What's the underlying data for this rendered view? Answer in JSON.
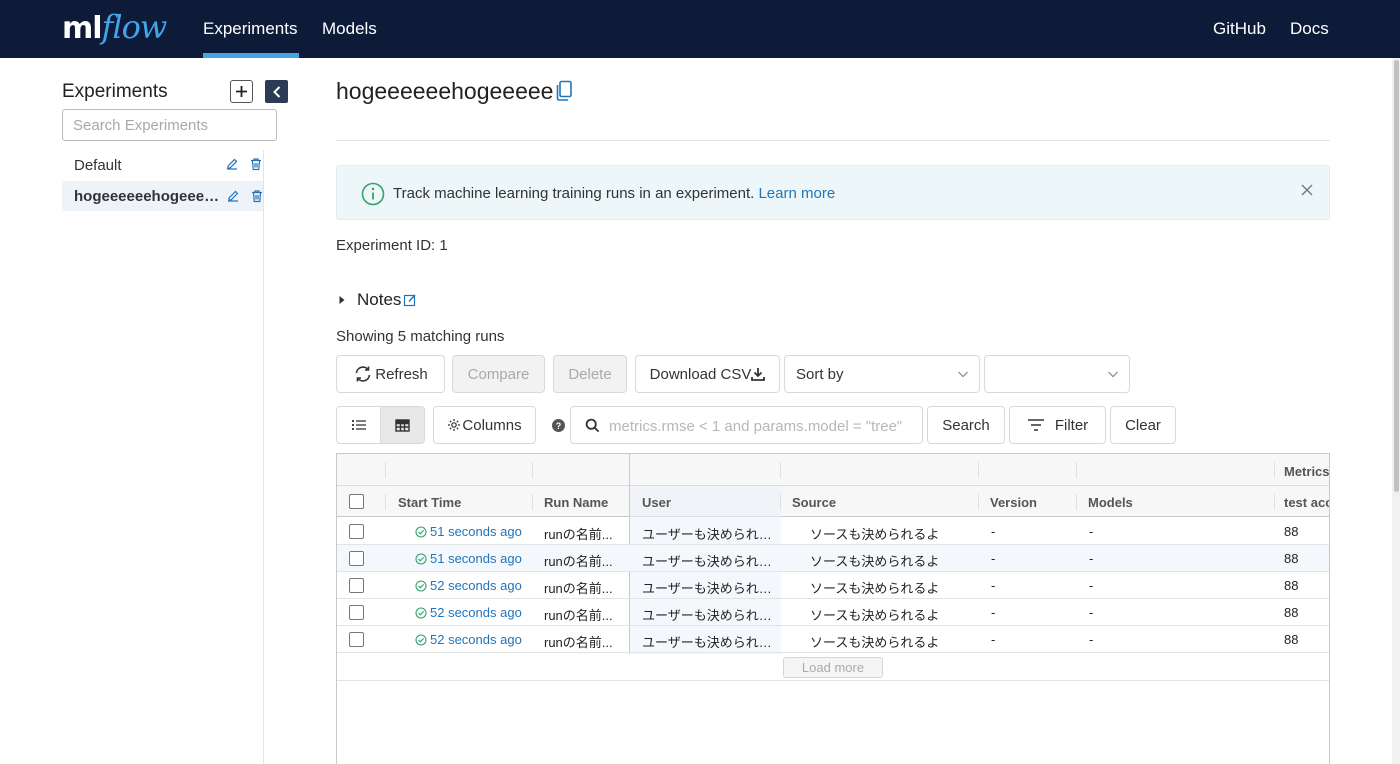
{
  "header": {
    "logo_ml": "ml",
    "logo_flow": "flow",
    "nav": [
      {
        "label": "Experiments",
        "active": true
      },
      {
        "label": "Models",
        "active": false
      }
    ],
    "links": {
      "github": "GitHub",
      "docs": "Docs"
    }
  },
  "sidebar": {
    "title": "Experiments",
    "search_placeholder": "Search Experiments",
    "experiments": [
      {
        "name": "Default",
        "active": false
      },
      {
        "name": "hogeeeeeehogeeeeee",
        "active": true
      }
    ]
  },
  "experiment": {
    "title": "hogeeeeeehogeeeee",
    "banner_text": "Track machine learning training runs in an experiment.",
    "banner_link": "Learn more",
    "id_label": "Experiment ID:",
    "id_value": "1",
    "notes_label": "Notes",
    "showing_text": "Showing 5 matching runs"
  },
  "toolbar": {
    "refresh": "Refresh",
    "compare": "Compare",
    "delete": "Delete",
    "download_csv": "Download CSV",
    "sort_by": "Sort by",
    "sort_order": "",
    "columns": "Columns",
    "search_placeholder": "metrics.rmse < 1 and params.model = \"tree\"",
    "search": "Search",
    "filter": "Filter",
    "clear": "Clear"
  },
  "table": {
    "group_header": "Metrics",
    "columns": [
      "Start Time",
      "Run Name",
      "User",
      "Source",
      "Version",
      "Models",
      "test acc"
    ],
    "rows": [
      {
        "start_time": "51 seconds ago",
        "run_name": "runの名前...",
        "user": "ユーザーも決められる...",
        "source": "ソースも決められるよ",
        "version": "-",
        "models": "-",
        "metric": "88"
      },
      {
        "start_time": "51 seconds ago",
        "run_name": "runの名前...",
        "user": "ユーザーも決められる...",
        "source": "ソースも決められるよ",
        "version": "-",
        "models": "-",
        "metric": "88"
      },
      {
        "start_time": "52 seconds ago",
        "run_name": "runの名前...",
        "user": "ユーザーも決められる...",
        "source": "ソースも決められるよ",
        "version": "-",
        "models": "-",
        "metric": "88"
      },
      {
        "start_time": "52 seconds ago",
        "run_name": "runの名前...",
        "user": "ユーザーも決められる...",
        "source": "ソースも決められるよ",
        "version": "-",
        "models": "-",
        "metric": "88"
      },
      {
        "start_time": "52 seconds ago",
        "run_name": "runの名前...",
        "user": "ユーザーも決められる...",
        "source": "ソースも決められるよ",
        "version": "-",
        "models": "-",
        "metric": "88"
      }
    ],
    "load_more": "Load more"
  },
  "colors": {
    "header_bg": "#0e1b38",
    "accent": "#43a5e8",
    "link": "#2374bb",
    "success": "#2fa36b"
  }
}
